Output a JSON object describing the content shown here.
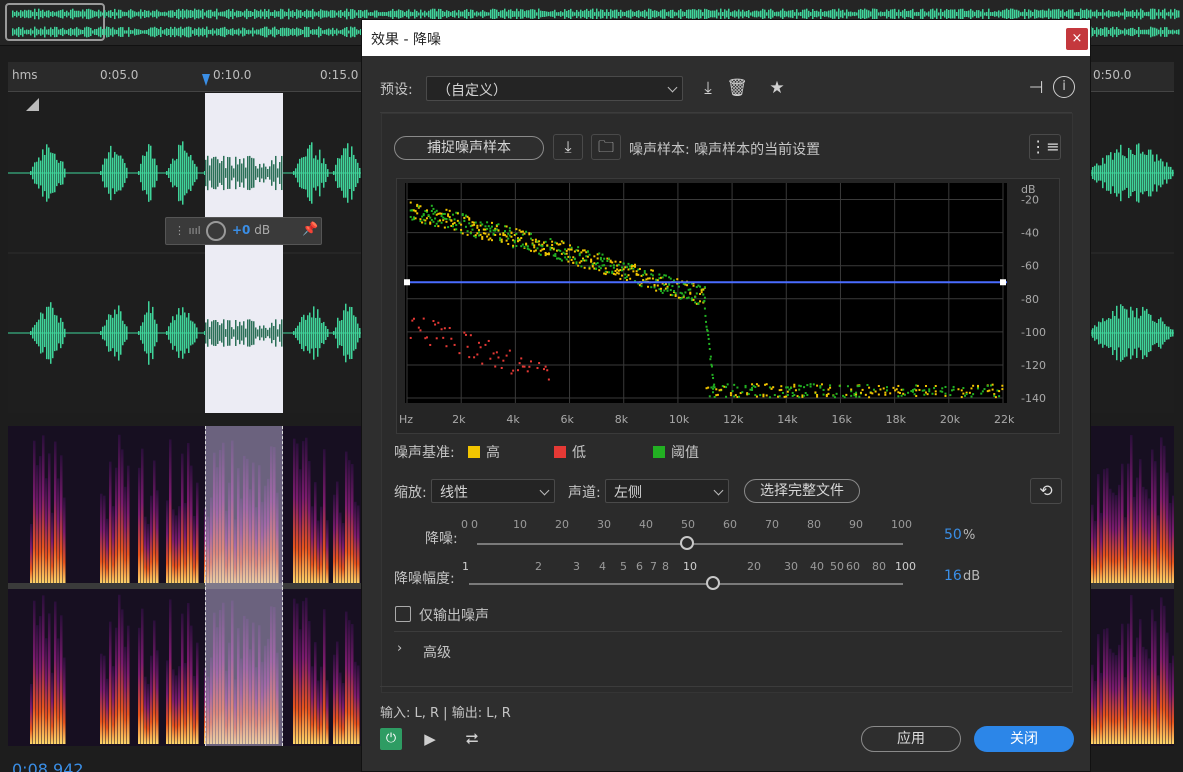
{
  "editor": {
    "ruler_labels": [
      "hms",
      "0:05.0",
      "0:10.0",
      "0:15.0",
      "0:50.0"
    ],
    "gain_value": "+0",
    "gain_unit": "dB",
    "current_time": "0:08.942"
  },
  "dialog": {
    "title": "效果 - 降噪",
    "close_glyph": "×",
    "preset_label": "预设:",
    "preset_value": "（自定义）",
    "capture_label": "捕捉噪声样本",
    "noise_sample_text": "噪声样本: 噪声样本的当前设置",
    "graph": {
      "y_unit": "dB",
      "y_ticks": [
        "-20",
        "-40",
        "-60",
        "-80",
        "-100",
        "-120",
        "-140"
      ],
      "x_ticks": [
        "Hz",
        "2k",
        "4k",
        "6k",
        "8k",
        "10k",
        "12k",
        "14k",
        "16k",
        "18k",
        "20k",
        "22k"
      ],
      "threshold_db": -70
    },
    "legend_label": "噪声基准:",
    "legend": [
      {
        "name": "高",
        "color": "#f2c500"
      },
      {
        "name": "低",
        "color": "#e53935"
      },
      {
        "name": "阈值",
        "color": "#22b022"
      }
    ],
    "scale_label": "缩放:",
    "scale_value": "线性",
    "channel_label": "声道:",
    "channel_value": "左侧",
    "select_file_label": "选择完整文件",
    "reduction_label": "降噪:",
    "reduction_ticks": [
      "0",
      "10",
      "20",
      "30",
      "40",
      "50",
      "60",
      "70",
      "80",
      "90",
      "100"
    ],
    "reduction_zero": "0",
    "reduction_value": "50",
    "reduction_unit": "%",
    "reduction_fraction": 0.5,
    "amount_label": "降噪幅度:",
    "amount_ticks": [
      "1",
      "2",
      "3",
      "4",
      "5",
      "6",
      "7",
      "8",
      "10",
      "20",
      "30",
      "40",
      "50",
      "60",
      "80",
      "100"
    ],
    "amount_value": "16",
    "amount_unit": "dB",
    "noise_only_label": "仅输出噪声",
    "advanced_label": "高级",
    "io_text": "输入: L, R | 输出: L, R",
    "apply_label": "应用",
    "close_label": "关闭",
    "accent_color": "#2c86e8"
  }
}
